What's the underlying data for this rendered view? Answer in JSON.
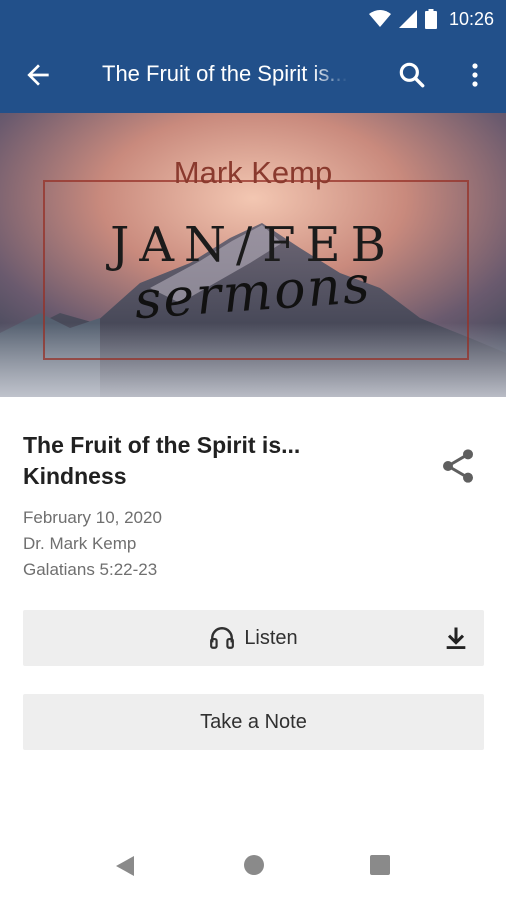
{
  "status_bar": {
    "time": "10:26"
  },
  "app_bar": {
    "title": "The Fruit of the Spirit is... Kindness"
  },
  "hero": {
    "brand": "Mark Kemp",
    "headline": "JAN/FEB",
    "script": "sermons"
  },
  "sermon": {
    "title": "The Fruit of the Spirit is... Kindness",
    "date": "February 10, 2020",
    "speaker": "Dr. Mark Kemp",
    "passage": "Galatians 5:22-23"
  },
  "actions": {
    "listen_label": "Listen",
    "note_label": "Take a Note"
  },
  "icons": {
    "back": "arrow-back-icon",
    "search": "search-icon",
    "more": "more-vert-icon",
    "share": "share-icon",
    "headphones": "headphones-icon",
    "download": "download-icon"
  },
  "colors": {
    "app_bar": "#22508a",
    "button_bg": "#eeeeee"
  }
}
